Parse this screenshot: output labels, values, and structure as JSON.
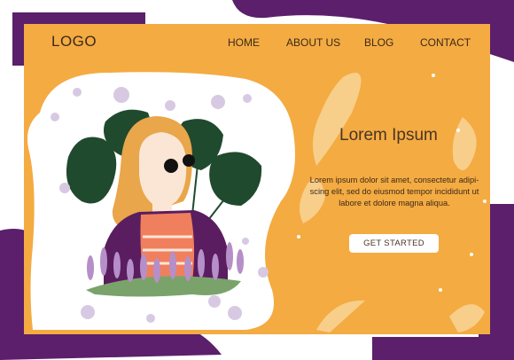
{
  "header": {
    "logo": "LOGO",
    "nav": [
      "HOME",
      "ABOUT US",
      "BLOG",
      "CONTACT"
    ]
  },
  "hero": {
    "title": "Lorem Ipsum",
    "body": "Lorem ipsum dolor sit amet, consectetur adipi-scing elit, sed do eiusmod tempor incididunt ut labore et dolore magna aliqua.",
    "cta_label": "GET STARTED"
  },
  "colors": {
    "page_background": "#ffffff",
    "frame": "#f4ab42",
    "purple_accent": "#5b1f6b",
    "blob": "#ffffff",
    "leaf_light": "#f8cf8a",
    "monstera": "#1f4a2d",
    "hair": "#e9a64a",
    "jacket": "#5a1d5f"
  },
  "icons": [
    "monstera-leaf-icon",
    "lavender-flower-icon",
    "decorative-leaf-icon",
    "bubble-dot-icon"
  ]
}
